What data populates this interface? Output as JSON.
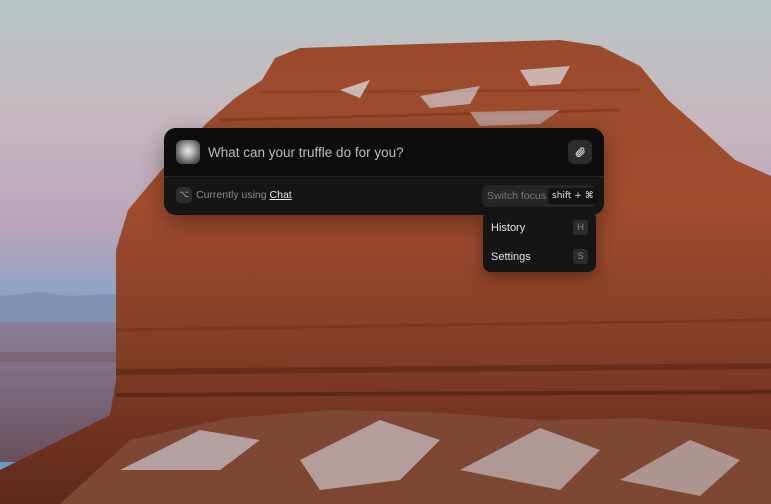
{
  "prompt": {
    "placeholder": "What can your truffle do for you?",
    "value": ""
  },
  "icons": {
    "orb": "truffle-orb-icon",
    "attach": "paperclip-icon",
    "option_key": "option-key-icon"
  },
  "status": {
    "option_glyph": "⌥",
    "prefix": "Currently using",
    "mode": "Chat"
  },
  "switch_focus": {
    "label": "Switch focus",
    "shortcut": "shift + ⌘"
  },
  "menu": {
    "items": [
      {
        "label": "History",
        "key": "H"
      },
      {
        "label": "Settings",
        "key": "S"
      }
    ]
  },
  "colors": {
    "panel": "#151515",
    "input_row": "#0d0d0d",
    "link": "#e8e8e8"
  }
}
